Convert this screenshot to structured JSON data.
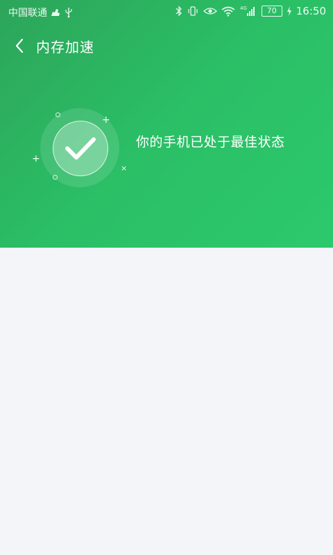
{
  "status_bar": {
    "carrier": "中国联通",
    "battery_level": "70",
    "time": "16:50",
    "network_type": "4G",
    "icons": {
      "notification": "cleaner-app-icon",
      "usb": "usb-icon",
      "bluetooth": "bluetooth-icon",
      "vibrate": "vibrate-icon",
      "eye_comfort": "eye-icon",
      "wifi": "wifi-icon",
      "signal": "signal-icon",
      "charging": "charging-icon"
    }
  },
  "nav": {
    "back_icon": "chevron-left-icon",
    "title": "内存加速"
  },
  "status": {
    "icon": "check-icon",
    "message": "你的手机已处于最佳状态"
  },
  "colors": {
    "accent_start": "#2ca55a",
    "accent_end": "#2cc96c",
    "content_background": "#f3f5f9"
  }
}
